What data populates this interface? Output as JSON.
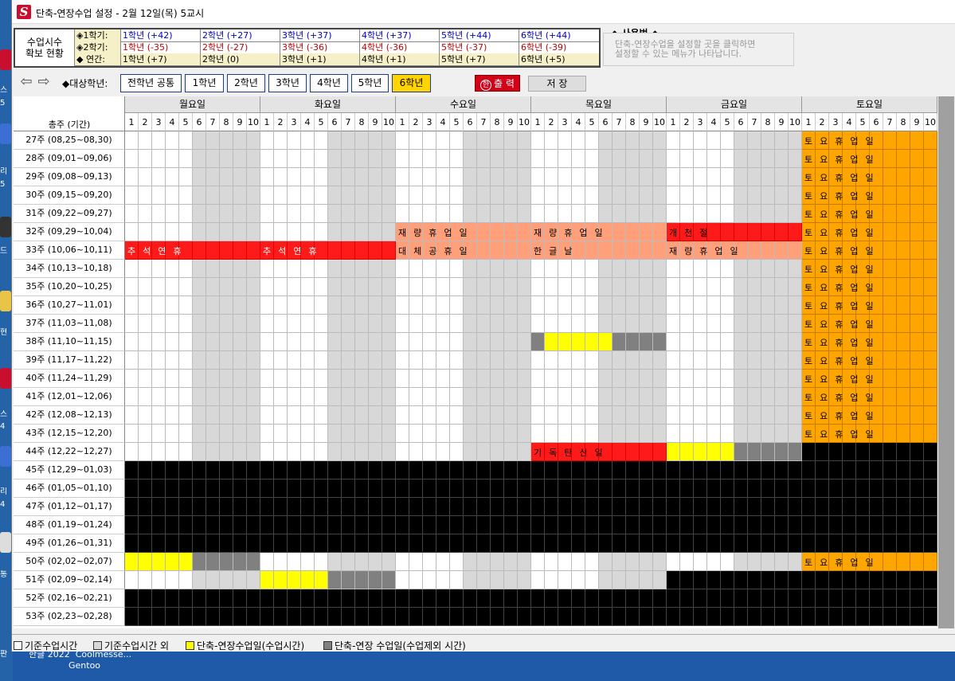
{
  "window": {
    "title": "단축-연장수업 설정 - 2월 12일(목) 5교시"
  },
  "desktop": {
    "side_labels": [
      "스",
      "5",
      "리",
      "5",
      "드",
      "현",
      "스",
      "4",
      "리",
      "4",
      "통",
      "판"
    ],
    "taskbar_labels": [
      "한글 2022",
      "Coolmesse...",
      "Gentoo"
    ]
  },
  "stats": {
    "heading": "수업시수\n확보 현황",
    "rows": [
      {
        "label": "◈1학기:",
        "color": "#0000c0",
        "values": [
          "1학년 (+42)",
          "2학년 (+27)",
          "3학년 (+37)",
          "4학년 (+37)",
          "5학년 (+44)",
          "6학년 (+44)"
        ]
      },
      {
        "label": "◈2학기:",
        "color": "#c00000",
        "values": [
          "1학년 (-35)",
          "2학년 (-27)",
          "3학년 (-36)",
          "4학년 (-36)",
          "5학년 (-37)",
          "6학년 (-39)"
        ]
      },
      {
        "label": "◆ 연간:",
        "color": "#000000",
        "values": [
          "1학년 (+7)",
          "2학년 (0)",
          "3학년 (+1)",
          "4학년 (+1)",
          "5학년 (+7)",
          "6학년 (+5)"
        ]
      }
    ]
  },
  "usage": {
    "title": "◆ 사용법 ◆",
    "text": "단축-연장수업을 설정할 곳을 클릭하면\n설정할 수 있는 메뉴가 나타납니다."
  },
  "toolbar": {
    "target_label": "◆대상학년:",
    "grades": [
      "전학년 공통",
      "1학년",
      "2학년",
      "3학년",
      "4학년",
      "5학년",
      "6학년"
    ],
    "active_grade": "6학년",
    "print_label": "출 력",
    "print_icon": "한",
    "save_label": "저 장"
  },
  "grid": {
    "week_header": "총주 (기간)",
    "days": [
      "월요일",
      "화요일",
      "수요일",
      "목요일",
      "금요일",
      "토요일"
    ],
    "periods": [
      "1",
      "2",
      "3",
      "4",
      "5",
      "6",
      "7",
      "8",
      "9",
      "10"
    ],
    "weeks": [
      "27주 (08,25~08,30)",
      "28주 (09,01~09,06)",
      "29주 (09,08~09,13)",
      "30주 (09,15~09,20)",
      "31주 (09,22~09,27)",
      "32주 (09,29~10,04)",
      "33주 (10,06~10,11)",
      "34주 (10,13~10,18)",
      "35주 (10,20~10,25)",
      "36주 (10,27~11,01)",
      "37주 (11,03~11,08)",
      "38주 (11,10~11,15)",
      "39주 (11,17~11,22)",
      "40주 (11,24~11,29)",
      "41주 (12,01~12,06)",
      "42주 (12,08~12,13)",
      "43주 (12,15~12,20)",
      "44주 (12,22~12,27)",
      "45주 (12,29~01,03)",
      "46주 (01,05~01,10)",
      "47주 (01,12~01,17)",
      "48주 (01,19~01,24)",
      "49주 (01,26~01,31)",
      "50주 (02,02~02,07)",
      "51주 (02,09~02,14)",
      "52주 (02,16~02,21)",
      "53주 (02,23~02,28)"
    ],
    "cell_colors": {
      "W": "#ffffff",
      "G": "#d8d8d8",
      "Y": "#ffff00",
      "D": "#808080",
      "R": "#ff1a1a",
      "S": "#ffa07a",
      "O": "#ffa500",
      "K": "#000000"
    },
    "matrix": [
      "WWWWWGGGGG WWWWWGGGGG WWWWWGGGGG WWWWWGGGGG WWWWWGGGGG OOOOOOOOOO",
      "WWWWWGGGGG WWWWWGGGGG WWWWWGGGGG WWWWWGGGGG WWWWWGGGGG OOOOOOOOOO",
      "WWWWWGGGGG WWWWWGGGGG WWWWWGGGGG WWWWWGGGGG WWWWWGGGGG OOOOOOOOOO",
      "WWWWWGGGGG WWWWWGGGGG WWWWWGGGGG WWWWWGGGGG WWWWWGGGGG OOOOOOOOOO",
      "WWWWWGGGGG WWWWWGGGGG WWWWWGGGGG WWWWWGGGGG WWWWWGGGGG OOOOOOOOOO",
      "WWWWWGGGGG WWWWWGGGGG SSSSSSSSSS SSSSSSSSSS RRRRRRRRRR OOOOOOOOOO",
      "RRRRRRRRRR RRRRRRRRRR SSSSSSSSSS SSSSSSSSSS SSSSSSSSSS OOOOOOOOOO",
      "WWWWWGGGGG WWWWWGGGGG WWWWWGGGGG WWWWWGGGGG WWWWWGGGGG OOOOOOOOOO",
      "WWWWWGGGGG WWWWWGGGGG WWWWWGGGGG WWWWWGGGGG WWWWWGGGGG OOOOOOOOOO",
      "WWWWWGGGGG WWWWWGGGGG WWWWWGGGGG WWWWWGGGGG WWWWWGGGGG OOOOOOOOOO",
      "WWWWWGGGGG WWWWWGGGGG WWWWWGGGGG WWWWWGGGGG WWWWWGGGGG OOOOOOOOOO",
      "WWWWWGGGGG WWWWWGGGGG WWWWWGGGGG DYYYYYDDDD WWWWWGGGGG OOOOOOOOOO",
      "WWWWWGGGGG WWWWWGGGGG WWWWWGGGGG WWWWWGGGGG WWWWWGGGGG OOOOOOOOOO",
      "WWWWWGGGGG WWWWWGGGGG WWWWWGGGGG WWWWWGGGGG WWWWWGGGGG OOOOOOOOOO",
      "WWWWWGGGGG WWWWWGGGGG WWWWWGGGGG WWWWWGGGGG WWWWWGGGGG OOOOOOOOOO",
      "WWWWWGGGGG WWWWWGGGGG WWWWWGGGGG WWWWWGGGGG WWWWWGGGGG OOOOOOOOOO",
      "WWWWWGGGGG WWWWWGGGGG WWWWWGGGGG WWWWWGGGGG WWWWWGGGGG OOOOOOOOOO",
      "WWWWWGGGGG WWWWWGGGGG WWWWWGGGGG RRRRRRRRRR YYYYYDDDDD KKKKKKKKKK",
      "KKKKKKKKKK KKKKKKKKKK KKKKKKKKKK KKKKKKKKKK KKKKKKKKKK KKKKKKKKKK",
      "KKKKKKKKKK KKKKKKKKKK KKKKKKKKKK KKKKKKKKKK KKKKKKKKKK KKKKKKKKKK",
      "KKKKKKKKKK KKKKKKKKKK KKKKKKKKKK KKKKKKKKKK KKKKKKKKKK KKKKKKKKKK",
      "KKKKKKKKKK KKKKKKKKKK KKKKKKKKKK KKKKKKKKKK KKKKKKKKKK KKKKKKKKKK",
      "KKKKKKKKKK KKKKKKKKKK KKKKKKKKKK KKKKKKKKKK KKKKKKKKKK KKKKKKKKKK",
      "YYYYYDDDDD WWWWWGGGGG WWWWWGGGGG WWWWWGGGGG WWWWWGGGGG OOOOOOOOOO",
      "WWWWWGGGGG YYYYYDDDDD WWWWWGGGGG WWWWWGGGGG KKKKKKKKKK KKKKKKKKKK",
      "KKKKKKKKKK KKKKKKKKKK KKKKKKKKKK KKKKKKKKKK KKKKKKKKKK KKKKKKKKKK",
      "KKKKKKKKKK KKKKKKKKKK KKKKKKKKKK KKKKKKKKKK KKKKKKKKKK KKKKKKKKKK"
    ],
    "sat_label": "토요휴업일",
    "events": [
      {
        "week": 5,
        "day": 2,
        "text": "재량휴업일"
      },
      {
        "week": 5,
        "day": 3,
        "text": "재량휴업일"
      },
      {
        "week": 5,
        "day": 4,
        "text": "개천절"
      },
      {
        "week": 6,
        "day": 0,
        "text": "추석연휴"
      },
      {
        "week": 6,
        "day": 1,
        "text": "추석연휴"
      },
      {
        "week": 6,
        "day": 2,
        "text": "대체공휴일"
      },
      {
        "week": 6,
        "day": 3,
        "text": "한글날"
      },
      {
        "week": 6,
        "day": 4,
        "text": "재량휴업일"
      },
      {
        "week": 17,
        "day": 3,
        "text": "기독탄신일"
      }
    ]
  },
  "legend": [
    {
      "label": "기준수업시간",
      "color": "#ffffff"
    },
    {
      "label": "기준수업시간 외",
      "color": "#d8d8d8"
    },
    {
      "label": "단축-연장수업일(수업시간)",
      "color": "#ffff00"
    },
    {
      "label": "단축-연장 수업일(수업제외 시간)",
      "color": "#808080"
    }
  ]
}
